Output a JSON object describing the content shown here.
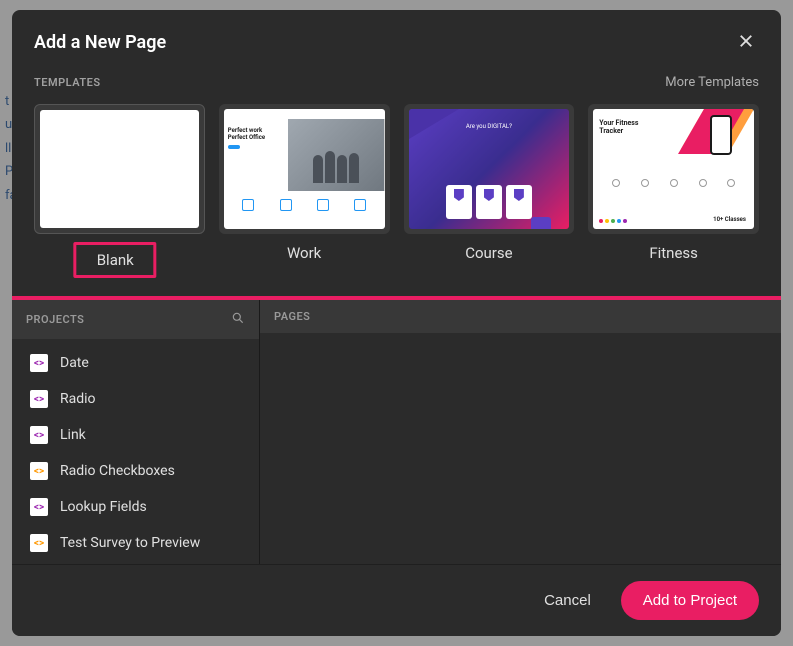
{
  "modal": {
    "title": "Add a New Page"
  },
  "templates": {
    "label": "TEMPLATES",
    "more": "More Templates",
    "items": [
      {
        "label": "Blank"
      },
      {
        "label": "Work"
      },
      {
        "label": "Course"
      },
      {
        "label": "Fitness"
      }
    ]
  },
  "work_thumb": {
    "line1": "Perfect work",
    "line2": "Perfect Office",
    "course_hint": "Are you DIGITAL?"
  },
  "fitness_thumb": {
    "title_line1": "Your Fitness",
    "title_line2": "Tracker",
    "classes": "10+ Classes"
  },
  "projects": {
    "label": "PROJECTS",
    "items": [
      {
        "label": "Date",
        "icon_class": "purple"
      },
      {
        "label": "Radio",
        "icon_class": "purple"
      },
      {
        "label": "Link",
        "icon_class": "purple"
      },
      {
        "label": "Radio Checkboxes",
        "icon_class": "orange"
      },
      {
        "label": "Lookup Fields",
        "icon_class": "purple"
      },
      {
        "label": "Test Survey to Preview",
        "icon_class": "orange"
      }
    ]
  },
  "pages": {
    "label": "PAGES"
  },
  "footer": {
    "cancel": "Cancel",
    "add": "Add to Project"
  }
}
